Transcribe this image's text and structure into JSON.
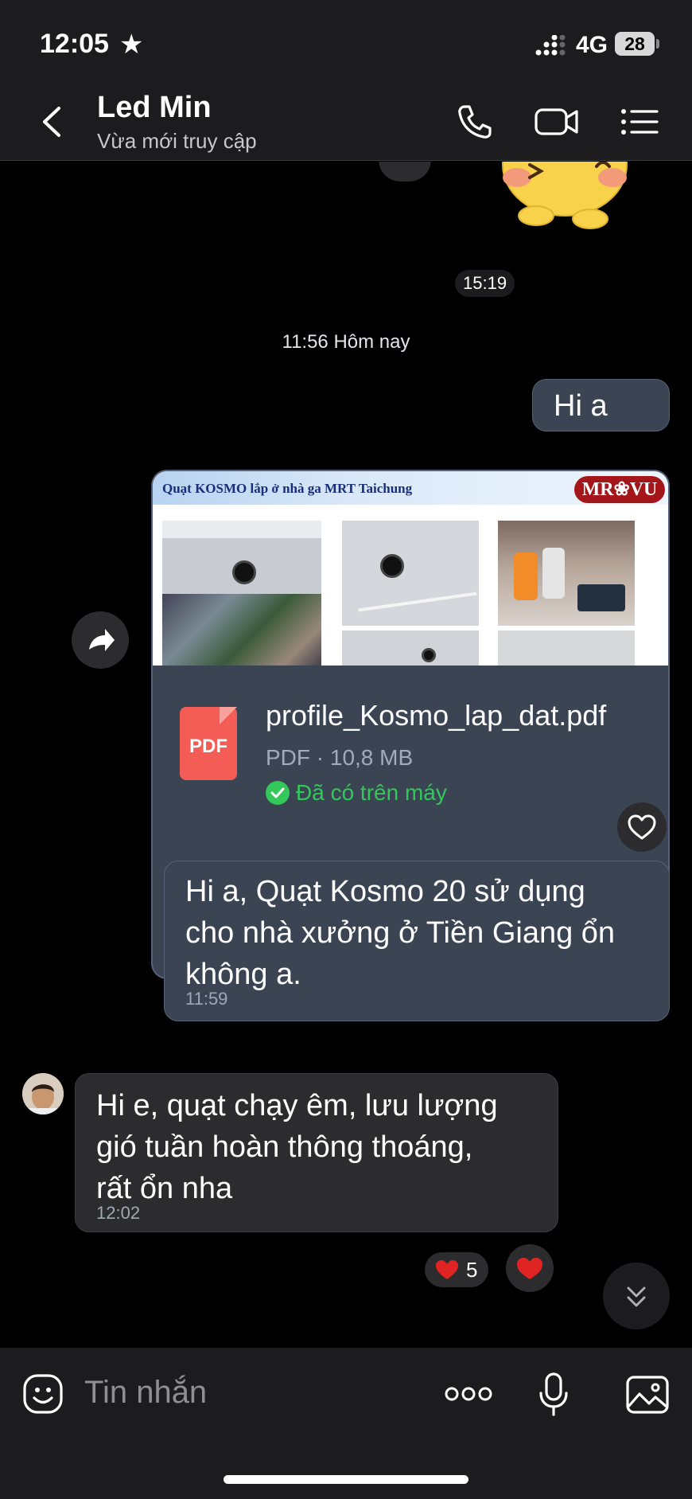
{
  "status": {
    "time": "12:05",
    "network": "4G",
    "battery": "28"
  },
  "header": {
    "contact_name": "Led Min",
    "presence": "Vừa mới truy cập"
  },
  "chat": {
    "earlier_time": "15:19",
    "day_separator": "11:56 Hôm nay",
    "messages": [
      {
        "id": "m1",
        "text": "Hi a"
      },
      {
        "id": "m2",
        "file": {
          "preview_title": "Quạt KOSMO lắp ở nhà ga MRT Taichung",
          "preview_logo": "MR❀VU",
          "icon_label": "PDF",
          "name": "profile_Kosmo_lap_dat.pdf",
          "meta": "PDF · 10,8 MB",
          "status": "Đã có trên máy"
        }
      },
      {
        "id": "m3",
        "line1": "Hi a, Quạt Kosmo 20 sử dụng",
        "line2": "cho nhà xưởng ở Tiền Giang ổn",
        "line3": "không a.",
        "time": "11:59"
      },
      {
        "id": "m4",
        "line1": "Hi e, quạt chạy êm, lưu lượng",
        "line2": "gió tuần hoàn thông thoáng,",
        "line3": "rất ổn nha",
        "time": "12:02",
        "reaction_count": "5"
      }
    ]
  },
  "composer": {
    "placeholder": "Tin nhắn"
  },
  "icons": {
    "back": "chevron-left-icon",
    "call": "phone-icon",
    "video": "video-camera-icon",
    "menu": "list-menu-icon",
    "forward": "share-arrow-icon",
    "heart": "heart-icon",
    "emoji": "emoji-icon",
    "more": "more-dots-icon",
    "mic": "microphone-icon",
    "image": "image-icon",
    "scroll": "double-chevron-down-icon"
  },
  "colors": {
    "outgoing_bubble": "#3a4453",
    "incoming_bubble": "#2c2c2e",
    "downloaded_green": "#34c759",
    "pdf_red": "#f35d56"
  }
}
